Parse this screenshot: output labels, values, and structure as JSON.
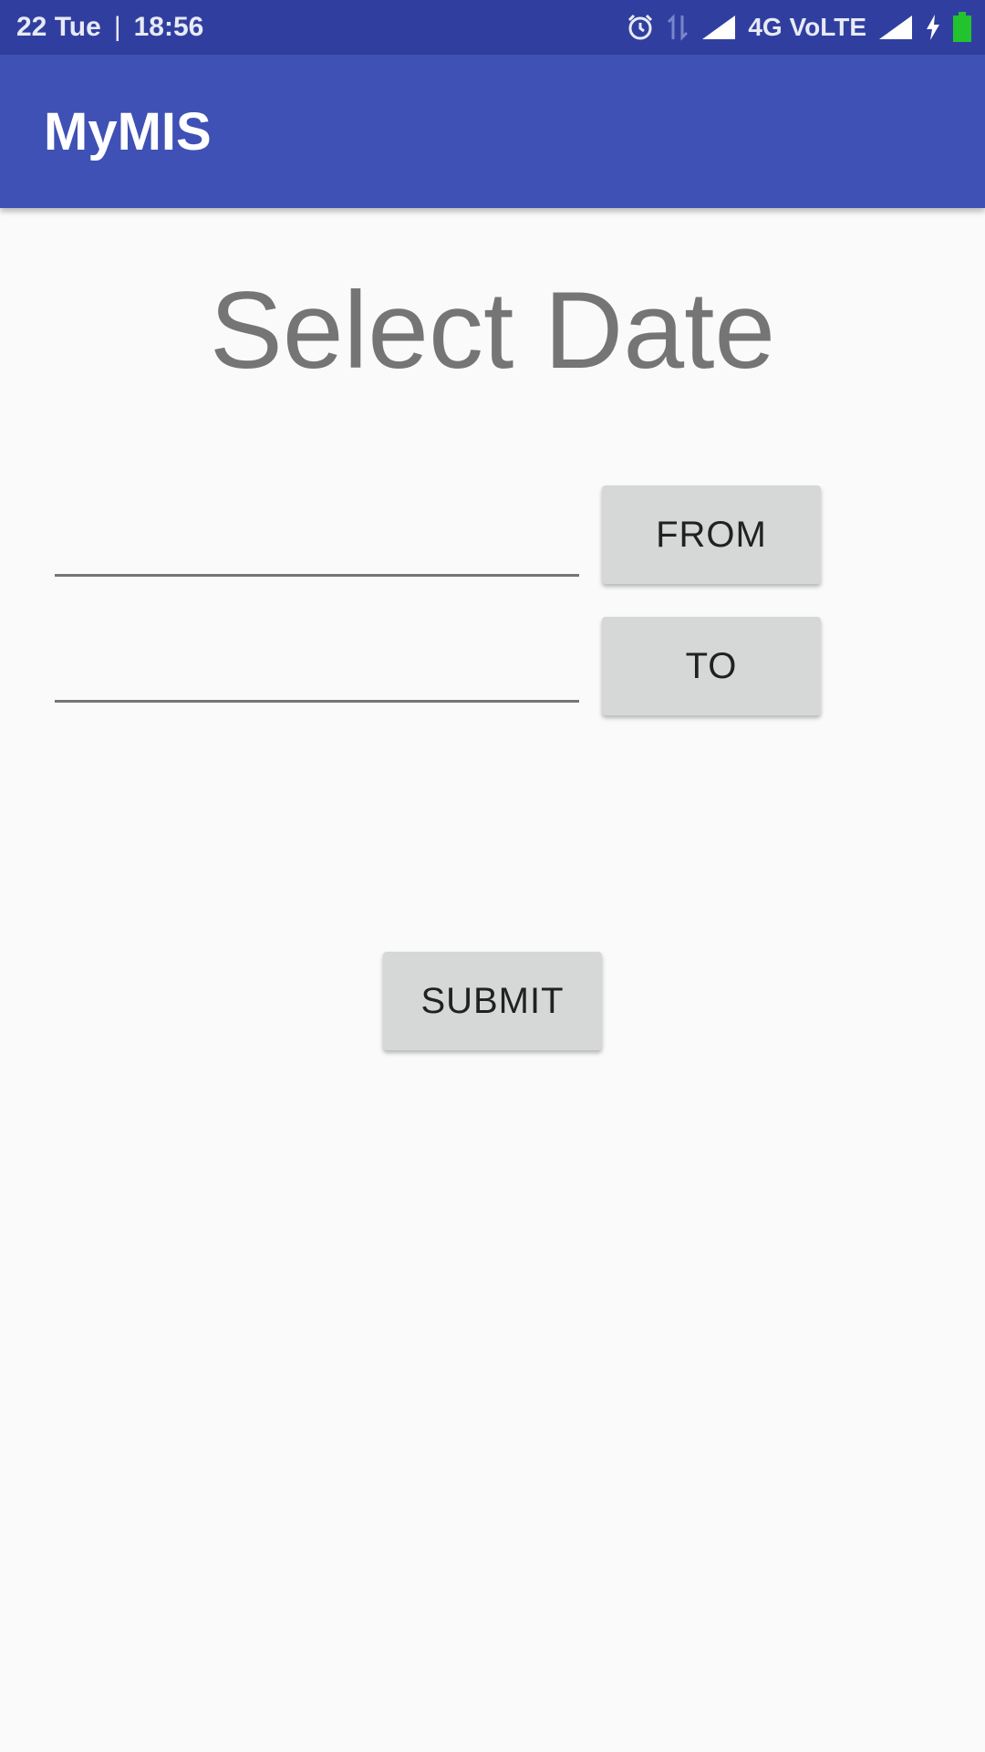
{
  "status_bar": {
    "date": "22 Tue",
    "separator": "|",
    "time": "18:56",
    "network": "4G VoLTE",
    "icons": [
      "alarm-icon",
      "data-arrows-icon",
      "signal-icon",
      "signal-icon",
      "charging-icon",
      "battery-icon"
    ],
    "battery_color": "#22c32e"
  },
  "app_bar": {
    "title": "MyMIS",
    "color": "#3f51b5",
    "status_color": "#303f9f"
  },
  "main": {
    "heading": "Select Date",
    "from_field": {
      "value": "",
      "placeholder": ""
    },
    "from_button": "FROM",
    "to_field": {
      "value": "",
      "placeholder": ""
    },
    "to_button": "TO",
    "submit_button": "SUBMIT"
  }
}
